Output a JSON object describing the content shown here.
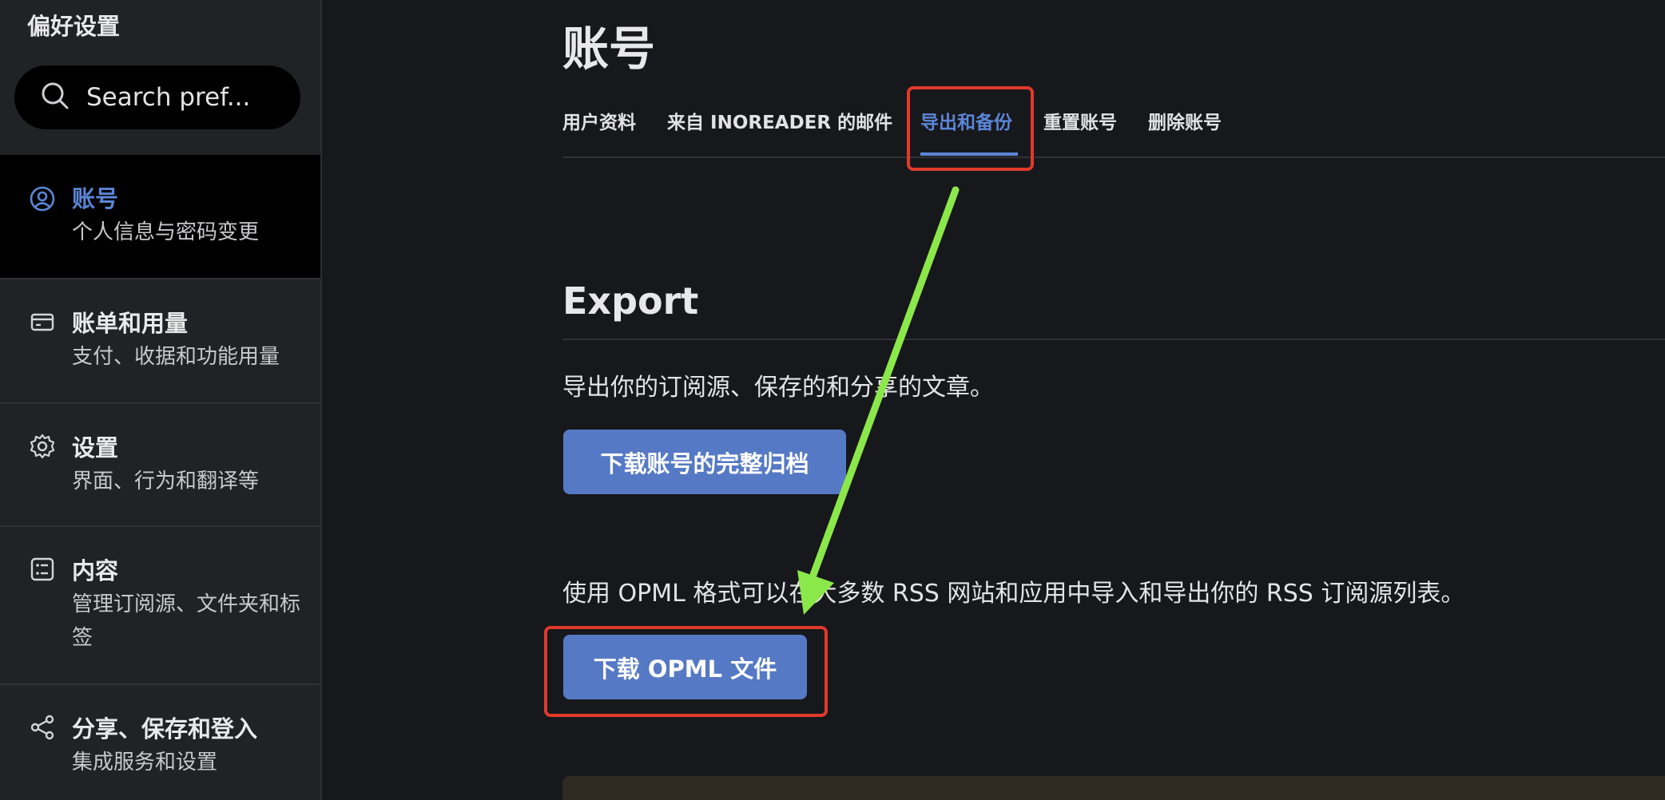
{
  "sidebar": {
    "title": "偏好设置",
    "search": {
      "placeholder": "Search pref..."
    },
    "items": [
      {
        "label": "账号",
        "desc": "个人信息与密码变更",
        "icon": "user-circle-icon",
        "active": true
      },
      {
        "label": "账单和用量",
        "desc": "支付、收据和功能用量",
        "icon": "credit-card-icon",
        "active": false
      },
      {
        "label": "设置",
        "desc": "界面、行为和翻译等",
        "icon": "gear-icon",
        "active": false
      },
      {
        "label": "内容",
        "desc": "管理订阅源、文件夹和标签",
        "icon": "list-icon",
        "active": false
      },
      {
        "label": "分享、保存和登入",
        "desc": "集成服务和设置",
        "icon": "share-icon",
        "active": false
      }
    ]
  },
  "main": {
    "title": "账号",
    "tabs": [
      {
        "label": "用户资料",
        "active": false
      },
      {
        "label": "来自 INOREADER 的邮件",
        "active": false
      },
      {
        "label": "导出和备份",
        "active": true
      },
      {
        "label": "重置账号",
        "active": false
      },
      {
        "label": "删除账号",
        "active": false
      }
    ],
    "export": {
      "heading": "Export",
      "description": "导出你的订阅源、保存的和分享的文章。",
      "archive_button": "下载账号的完整归档",
      "opml_description": "使用 OPML 格式可以在大多数 RSS 网站和应用中导入和导出你的 RSS 订阅源列表。",
      "opml_button": "下载 OPML 文件"
    }
  },
  "colors": {
    "accent": "#5b86d6",
    "button": "#5579c4",
    "annotation_box": "#e03a2b",
    "annotation_arrow": "#8be84a"
  }
}
